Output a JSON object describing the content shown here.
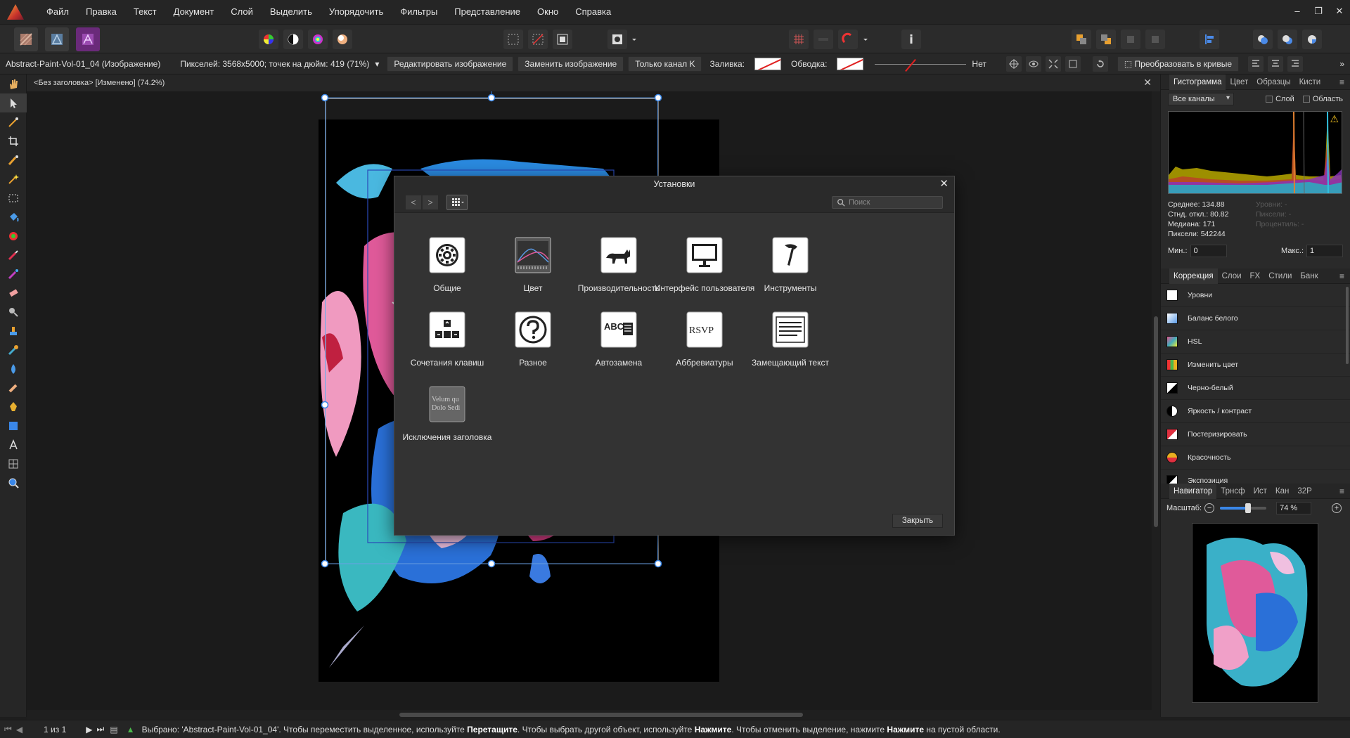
{
  "menu": [
    "Файл",
    "Правка",
    "Текст",
    "Документ",
    "Слой",
    "Выделить",
    "Упорядочить",
    "Фильтры",
    "Представление",
    "Окно",
    "Справка"
  ],
  "window": {
    "minimize": "–",
    "restore": "❐",
    "close": "✕"
  },
  "context": {
    "filename": "Abstract-Paint-Vol-01_04 (Изображение)",
    "pixels": "Пикселей: 3568x5000; точек на дюйм: 419 (71%)",
    "edit_image": "Редактировать изображение",
    "replace_image": "Заменить изображение",
    "k_only": "Только канал K",
    "fill_label": "Заливка:",
    "stroke_label": "Обводка:",
    "none_label": "Нет",
    "convert_curves": "Преобразовать в кривые",
    "more": "»"
  },
  "document": {
    "tab": "<Без заголовка> [Изменено] (74.2%)",
    "close": "✕"
  },
  "histogram_panel": {
    "tabs": [
      "Гистограмма",
      "Цвет",
      "Образцы",
      "Кисти"
    ],
    "menu": "≡",
    "channel": "Все каналы",
    "layer_label": "Слой",
    "area_label": "Область",
    "warning": "⚠",
    "mean": "Среднее: 134.88",
    "stddev": "Стнд. откл.: 80.82",
    "median": "Медиана: 171",
    "pixels": "Пиксели: 542244",
    "levels": "Уровни: -",
    "pixels2": "Пиксели: -",
    "percentile": "Процентиль: -",
    "min_label": "Мин.:",
    "min_value": "0",
    "max_label": "Макс.:",
    "max_value": "1"
  },
  "adjust_panel": {
    "tabs": [
      "Коррекция",
      "Слои",
      "FX",
      "Стили",
      "Банк"
    ],
    "menu": "≡",
    "items": [
      {
        "label": "Уровни",
        "color": "#ffffff",
        "icon": "levels-icon"
      },
      {
        "label": "Баланс белого",
        "color": "#5a9ae6",
        "icon": "white-balance-icon"
      },
      {
        "label": "HSL",
        "color": "#e0558a",
        "icon": "hsl-icon"
      },
      {
        "label": "Изменить цвет",
        "color": "#4bb94b",
        "icon": "replace-color-icon"
      },
      {
        "label": "Черно-белый",
        "color": "#e8e8e8",
        "icon": "black-white-icon"
      },
      {
        "label": "Яркость / контраст",
        "color": "#f0f0f0",
        "icon": "brightness-contrast-icon"
      },
      {
        "label": "Постеризировать",
        "color": "#e03040",
        "icon": "posterize-icon"
      },
      {
        "label": "Красочность",
        "color": "#e8b020",
        "icon": "vibrance-icon"
      },
      {
        "label": "Экспозиция",
        "color": "#222222",
        "icon": "exposure-icon"
      }
    ]
  },
  "navigator_panel": {
    "tabs": [
      "Навигатор",
      "Трнсф",
      "Ист",
      "Кан",
      "32Р"
    ],
    "menu": "≡",
    "zoom_label": "Масштаб:",
    "zoom_value": "74 %",
    "zoom_fraction": 0.6,
    "minus": "−",
    "plus": "+"
  },
  "status": {
    "page": "1 из 1",
    "text_a": "Выбрано: 'Abstract-Paint-Vol-01_04'. Чтобы переместить выделенное, используйте ",
    "bold_a": "Перетащите",
    "text_b": ". Чтобы выбрать другой объект, используйте ",
    "bold_b": "Нажмите",
    "text_c": ". Чтобы отменить выделение, нажмите ",
    "bold_c": "Нажмите",
    "text_d": " на пустой области."
  },
  "dialog": {
    "title": "Установки",
    "close": "✕",
    "back": "<",
    "forward": ">",
    "search_placeholder": "Поиск",
    "close_button": "Закрыть",
    "items": [
      {
        "label": "Общие",
        "icon": "gear-icon"
      },
      {
        "label": "Цвет",
        "icon": "color-icon"
      },
      {
        "label": "Производительность",
        "icon": "cat-icon"
      },
      {
        "label": "Интерфейс пользователя",
        "icon": "monitor-icon"
      },
      {
        "label": "Инструменты",
        "icon": "hammer-icon"
      },
      {
        "label": "Сочетания клавиш",
        "icon": "keyboard-icon"
      },
      {
        "label": "Разное",
        "icon": "question-icon"
      },
      {
        "label": "Автозамена",
        "icon": "autocorrect-icon"
      },
      {
        "label": "Аббревиатуры",
        "icon": "rsvp-icon"
      },
      {
        "label": "Замещающий текст",
        "icon": "placeholder-text-icon"
      },
      {
        "label": "Исключения заголовка",
        "icon": "title-exceptions-icon"
      }
    ],
    "rsvp_text": "RSVP",
    "abc_text": "ABC",
    "lorem_line1": "Velum qu",
    "lorem_line2": "Dolo Sedi"
  }
}
